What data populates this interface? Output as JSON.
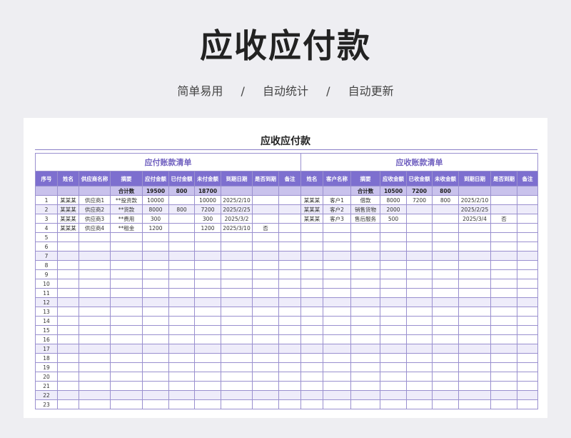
{
  "page": {
    "title": "应收应付款",
    "features": [
      "简单易用",
      "自动统计",
      "自动更新"
    ],
    "separator": "/"
  },
  "sheet": {
    "title": "应收应付款",
    "payable": {
      "section_title": "应付账款清单",
      "headers": [
        "序号",
        "姓名",
        "供应商名称",
        "摘要",
        "应付金额",
        "已付金额",
        "未付金额",
        "到期日期",
        "是否到期",
        "备注"
      ],
      "total_label": "合计数",
      "totals": {
        "due": "19500",
        "paid": "800",
        "unpaid": "18700"
      },
      "rows": [
        [
          "1",
          "某某某",
          "供应商1",
          "**投资款",
          "10000",
          "",
          "10000",
          "2025/2/10",
          "",
          ""
        ],
        [
          "2",
          "某某某",
          "供应商2",
          "**货款",
          "8000",
          "800",
          "7200",
          "2025/2/25",
          "",
          ""
        ],
        [
          "3",
          "某某某",
          "供应商3",
          "**费用",
          "300",
          "",
          "300",
          "2025/3/2",
          "",
          ""
        ],
        [
          "4",
          "某某某",
          "供应商4",
          "**租金",
          "1200",
          "",
          "1200",
          "2025/3/10",
          "否",
          ""
        ],
        [
          "5",
          "",
          "",
          "",
          "",
          "",
          "",
          "",
          "",
          ""
        ],
        [
          "6",
          "",
          "",
          "",
          "",
          "",
          "",
          "",
          "",
          ""
        ],
        [
          "7",
          "",
          "",
          "",
          "",
          "",
          "",
          "",
          "",
          ""
        ],
        [
          "8",
          "",
          "",
          "",
          "",
          "",
          "",
          "",
          "",
          ""
        ],
        [
          "9",
          "",
          "",
          "",
          "",
          "",
          "",
          "",
          "",
          ""
        ],
        [
          "10",
          "",
          "",
          "",
          "",
          "",
          "",
          "",
          "",
          ""
        ],
        [
          "11",
          "",
          "",
          "",
          "",
          "",
          "",
          "",
          "",
          ""
        ],
        [
          "12",
          "",
          "",
          "",
          "",
          "",
          "",
          "",
          "",
          ""
        ],
        [
          "13",
          "",
          "",
          "",
          "",
          "",
          "",
          "",
          "",
          ""
        ],
        [
          "14",
          "",
          "",
          "",
          "",
          "",
          "",
          "",
          "",
          ""
        ],
        [
          "15",
          "",
          "",
          "",
          "",
          "",
          "",
          "",
          "",
          ""
        ],
        [
          "16",
          "",
          "",
          "",
          "",
          "",
          "",
          "",
          "",
          ""
        ],
        [
          "17",
          "",
          "",
          "",
          "",
          "",
          "",
          "",
          "",
          ""
        ],
        [
          "18",
          "",
          "",
          "",
          "",
          "",
          "",
          "",
          "",
          ""
        ],
        [
          "19",
          "",
          "",
          "",
          "",
          "",
          "",
          "",
          "",
          ""
        ],
        [
          "20",
          "",
          "",
          "",
          "",
          "",
          "",
          "",
          "",
          ""
        ],
        [
          "21",
          "",
          "",
          "",
          "",
          "",
          "",
          "",
          "",
          ""
        ],
        [
          "22",
          "",
          "",
          "",
          "",
          "",
          "",
          "",
          "",
          ""
        ],
        [
          "23",
          "",
          "",
          "",
          "",
          "",
          "",
          "",
          "",
          ""
        ]
      ]
    },
    "receivable": {
      "section_title": "应收账款清单",
      "headers": [
        "姓名",
        "客户名称",
        "摘要",
        "应收金额",
        "已收金额",
        "未收金额",
        "到期日期",
        "是否到期",
        "备注"
      ],
      "total_label": "合计数",
      "totals": {
        "due": "10500",
        "received": "7200",
        "unreceived": "800"
      },
      "rows": [
        [
          "某某某",
          "客户1",
          "借款",
          "8000",
          "7200",
          "800",
          "2025/2/10",
          "",
          ""
        ],
        [
          "某某某",
          "客户2",
          "销售货物",
          "2000",
          "",
          "",
          "2025/2/25",
          "",
          ""
        ],
        [
          "某某某",
          "客户3",
          "售后服务",
          "500",
          "",
          "",
          "2025/3/4",
          "否",
          ""
        ]
      ]
    }
  }
}
